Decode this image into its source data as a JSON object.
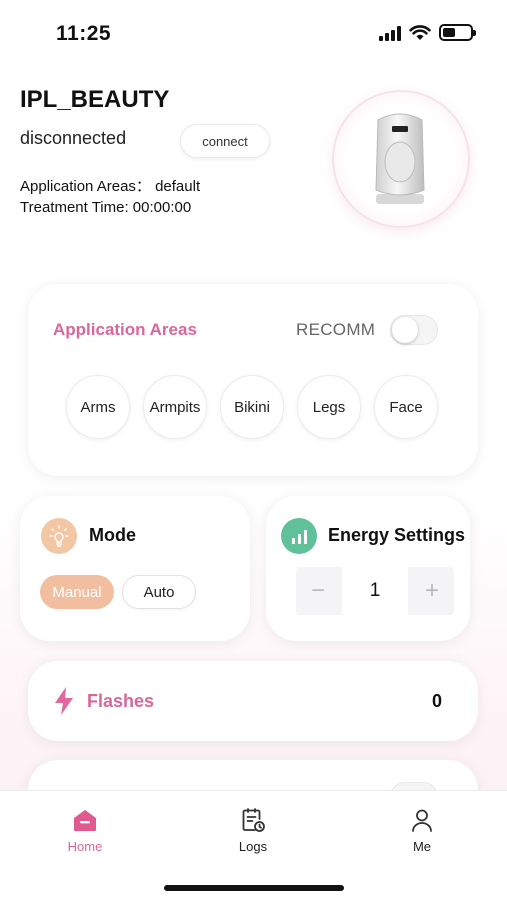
{
  "status_bar": {
    "time": "11:25"
  },
  "device": {
    "name": "IPL_BEAUTY",
    "connection_status": "disconnected",
    "connect_label": "connect",
    "application_areas_line": "Application Areas： default",
    "treatment_time_line": "Treatment Time: 00:00:00"
  },
  "areas": {
    "title": "Application Areas",
    "recomm_label": "RECOMM",
    "recomm_on": false,
    "items": [
      "Arms",
      "Armpits",
      "Bikini",
      "Legs",
      "Face"
    ]
  },
  "mode": {
    "title": "Mode",
    "options": [
      "Manual",
      "Auto"
    ],
    "selected": "Manual"
  },
  "energy": {
    "title": "Energy Settings",
    "value": "1",
    "minus": "−",
    "plus": "+"
  },
  "flashes": {
    "label": "Flashes",
    "count": "0"
  },
  "tabs": [
    {
      "label": "Home",
      "icon": "home-icon",
      "active": true
    },
    {
      "label": "Logs",
      "icon": "logs-icon",
      "active": false
    },
    {
      "label": "Me",
      "icon": "user-icon",
      "active": false
    }
  ],
  "colors": {
    "accent_pink": "#d9689a",
    "mode_orange": "#f1bf9f",
    "energy_green": "#5fc09a"
  }
}
